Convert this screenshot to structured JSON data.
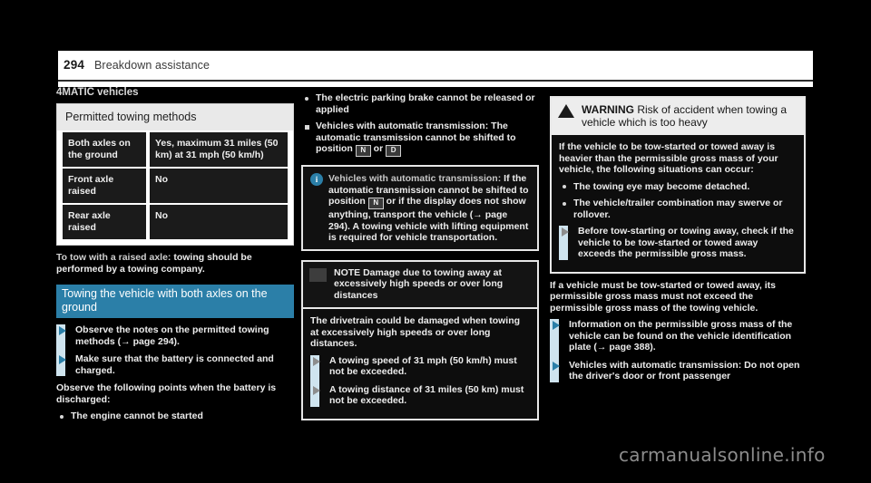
{
  "header": {
    "page_number": "294",
    "title": "Breakdown assistance"
  },
  "col1": {
    "subhead": "4MATIC vehicles",
    "table": {
      "caption": "Permitted towing methods",
      "rows": [
        {
          "method": "Both axles on the ground",
          "value": "Yes, maximum 31 miles (50 km) at 31 mph (50 km/h)"
        },
        {
          "method": "Front axle raised",
          "value": "No"
        },
        {
          "method": "Rear axle raised",
          "value": "No"
        }
      ]
    },
    "para_lead": "To tow with a raised axle:",
    "para_text": " towing should be performed by a towing company.",
    "section_heading": "Towing the vehicle with both axles on the ground",
    "actions": [
      "Observe the notes on the permitted towing methods (→ page 294).",
      "Make sure that the battery is connected and charged."
    ],
    "discharged_intro": "Observe the following points when the battery is discharged:",
    "discharged_bullets": [
      "The engine cannot be started"
    ]
  },
  "col2": {
    "bullets": [
      {
        "type": "dot",
        "text": "The electric parking brake cannot be released or applied"
      },
      {
        "type": "square",
        "lead": "Vehicles with automatic transmission:",
        "text": " The automatic transmission cannot be shifted to position ",
        "glyph1": "N",
        "mid": " or ",
        "glyph2": "D"
      }
    ],
    "note": {
      "icon": "info-icon",
      "icon_char": "i",
      "lead": "Vehicles with automatic transmission:",
      "text": " If the automatic transmission cannot be shifted to position ",
      "glyph": "N",
      "text2": " or if the display does not show anything, transport the vehicle (→ page 294). A towing vehicle with lifting equipment is required for vehicle transportation."
    },
    "notice": {
      "label": "NOTE",
      "headline": "Damage due to towing away at excessively high speeds or over long distances",
      "body": "The drivetrain could be damaged when towing at excessively high speeds or over long distances.",
      "actions": [
        "A towing speed of 31 mph (50 km/h) must not be exceeded.",
        "A towing distance of 31 miles (50 km) must not be exceeded."
      ]
    }
  },
  "col3": {
    "warning": {
      "label": "WARNING",
      "headline": "Risk of accident when towing a vehicle which is too heavy",
      "body": "If the vehicle to be tow-started or towed away is heavier than the permissible gross mass of your vehicle, the following situations can occur:",
      "bullets": [
        "The towing eye may become detached.",
        "The vehicle/trailer combination may swerve or rollover."
      ],
      "actions": [
        "Before tow-starting or towing away, check if the vehicle to be tow-started or towed away exceeds the permissible gross mass."
      ]
    },
    "para": "If a vehicle must be tow-started or towed away, its permissible gross mass must not exceed the permissible gross mass of the towing vehicle.",
    "actions": [
      {
        "text": "Information on the permissible gross mass of the vehicle can be found on the vehicle identification plate (→ page 388)."
      },
      {
        "lead": "Vehicles with automatic transmission:",
        "text": " Do not open the driver's door or front passenger"
      }
    ]
  },
  "watermark": "carmanualsonline.info"
}
